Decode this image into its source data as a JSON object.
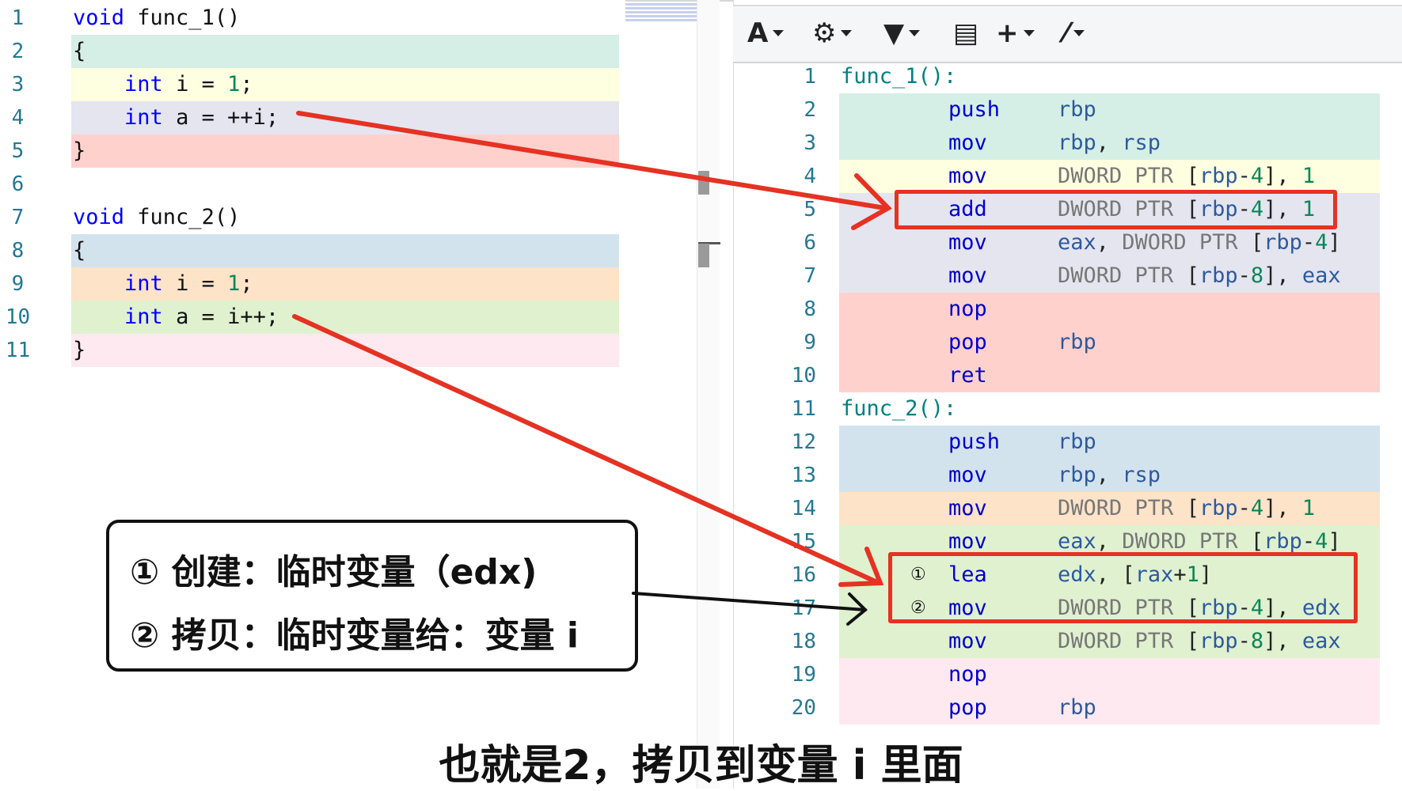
{
  "source_editor": {
    "lines": [
      {
        "num": "1",
        "tokens": [
          {
            "t": "void",
            "c": "kw"
          },
          {
            "t": " func_1()",
            "c": ""
          }
        ],
        "bg": ""
      },
      {
        "num": "2",
        "tokens": [
          {
            "t": "{",
            "c": ""
          }
        ],
        "bg": "#d5efe6"
      },
      {
        "num": "3",
        "tokens": [
          {
            "t": "    ",
            "c": ""
          },
          {
            "t": "int",
            "c": "kw"
          },
          {
            "t": " i = ",
            "c": ""
          },
          {
            "t": "1",
            "c": "num"
          },
          {
            "t": ";",
            "c": ""
          }
        ],
        "bg": "#fefee0"
      },
      {
        "num": "4",
        "tokens": [
          {
            "t": "    ",
            "c": ""
          },
          {
            "t": "int",
            "c": "kw"
          },
          {
            "t": " a = ++i;",
            "c": ""
          }
        ],
        "bg": "#e5e5f0"
      },
      {
        "num": "5",
        "tokens": [
          {
            "t": "}",
            "c": ""
          }
        ],
        "bg": "#ffd1cd"
      },
      {
        "num": "6",
        "tokens": [],
        "bg": ""
      },
      {
        "num": "7",
        "tokens": [
          {
            "t": "void",
            "c": "kw"
          },
          {
            "t": " func_2()",
            "c": ""
          }
        ],
        "bg": ""
      },
      {
        "num": "8",
        "tokens": [
          {
            "t": "{",
            "c": ""
          }
        ],
        "bg": "#d3e3ee"
      },
      {
        "num": "9",
        "tokens": [
          {
            "t": "    ",
            "c": ""
          },
          {
            "t": "int",
            "c": "kw"
          },
          {
            "t": " i = ",
            "c": ""
          },
          {
            "t": "1",
            "c": "num"
          },
          {
            "t": ";",
            "c": ""
          }
        ],
        "bg": "#fde3c8"
      },
      {
        "num": "10",
        "tokens": [
          {
            "t": "    ",
            "c": ""
          },
          {
            "t": "int",
            "c": "kw"
          },
          {
            "t": " a = i++;",
            "c": ""
          }
        ],
        "bg": "#e0f1cf"
      },
      {
        "num": "11",
        "tokens": [
          {
            "t": "}",
            "c": ""
          }
        ],
        "bg": "#fde9ef"
      }
    ]
  },
  "toolbar": {
    "buttons": [
      {
        "name": "font-button",
        "icon": "font-icon",
        "glyph": "A"
      },
      {
        "name": "settings-button",
        "icon": "gear-icon",
        "glyph": "⚙"
      },
      {
        "name": "filter-button",
        "icon": "filter-icon",
        "glyph": "▼"
      },
      {
        "name": "libraries-button",
        "icon": "book-icon",
        "glyph": "▤"
      },
      {
        "name": "add-button",
        "icon": "plus-icon",
        "glyph": "+"
      },
      {
        "name": "tools-button",
        "icon": "wrench-icon",
        "glyph": "⁄"
      }
    ]
  },
  "asm_output": {
    "lines": [
      {
        "num": "1",
        "label": "func_1():",
        "bg": "",
        "mn": "",
        "op": []
      },
      {
        "num": "2",
        "mn": "push",
        "op": [
          {
            "t": "rbp",
            "c": "reg"
          }
        ],
        "bg": "#d5efe6"
      },
      {
        "num": "3",
        "mn": "mov",
        "op": [
          {
            "t": "rbp",
            "c": "reg"
          },
          {
            "t": ", ",
            "c": "p"
          },
          {
            "t": "rsp",
            "c": "reg"
          }
        ],
        "bg": "#d5efe6"
      },
      {
        "num": "4",
        "mn": "mov",
        "op": [
          {
            "t": "DWORD PTR ",
            "c": "g"
          },
          {
            "t": "[",
            "c": "br"
          },
          {
            "t": "rbp",
            "c": "reg"
          },
          {
            "t": "-",
            "c": "p"
          },
          {
            "t": "4",
            "c": "n"
          },
          {
            "t": "]",
            "c": "br"
          },
          {
            "t": ", ",
            "c": "p"
          },
          {
            "t": "1",
            "c": "n"
          }
        ],
        "bg": "#fefee0"
      },
      {
        "num": "5",
        "mn": "add",
        "op": [
          {
            "t": "DWORD PTR ",
            "c": "g"
          },
          {
            "t": "[",
            "c": "br"
          },
          {
            "t": "rbp",
            "c": "reg"
          },
          {
            "t": "-",
            "c": "p"
          },
          {
            "t": "4",
            "c": "n"
          },
          {
            "t": "]",
            "c": "br"
          },
          {
            "t": ", ",
            "c": "p"
          },
          {
            "t": "1",
            "c": "n"
          }
        ],
        "bg": "#e5e5f0"
      },
      {
        "num": "6",
        "mn": "mov",
        "op": [
          {
            "t": "eax",
            "c": "reg"
          },
          {
            "t": ", ",
            "c": "p"
          },
          {
            "t": "DWORD PTR ",
            "c": "g"
          },
          {
            "t": "[",
            "c": "br"
          },
          {
            "t": "rbp",
            "c": "reg"
          },
          {
            "t": "-",
            "c": "p"
          },
          {
            "t": "4",
            "c": "n"
          },
          {
            "t": "]",
            "c": "br"
          }
        ],
        "bg": "#e5e5f0"
      },
      {
        "num": "7",
        "mn": "mov",
        "op": [
          {
            "t": "DWORD PTR ",
            "c": "g"
          },
          {
            "t": "[",
            "c": "br"
          },
          {
            "t": "rbp",
            "c": "reg"
          },
          {
            "t": "-",
            "c": "p"
          },
          {
            "t": "8",
            "c": "n"
          },
          {
            "t": "]",
            "c": "br"
          },
          {
            "t": ", ",
            "c": "p"
          },
          {
            "t": "eax",
            "c": "reg"
          }
        ],
        "bg": "#e5e5f0"
      },
      {
        "num": "8",
        "mn": "nop",
        "op": [],
        "bg": "#ffd1cd"
      },
      {
        "num": "9",
        "mn": "pop",
        "op": [
          {
            "t": "rbp",
            "c": "reg"
          }
        ],
        "bg": "#ffd1cd"
      },
      {
        "num": "10",
        "mn": "ret",
        "op": [],
        "bg": "#ffd1cd"
      },
      {
        "num": "11",
        "label": "func_2():",
        "bg": "",
        "mn": "",
        "op": []
      },
      {
        "num": "12",
        "mn": "push",
        "op": [
          {
            "t": "rbp",
            "c": "reg"
          }
        ],
        "bg": "#d3e3ee"
      },
      {
        "num": "13",
        "mn": "mov",
        "op": [
          {
            "t": "rbp",
            "c": "reg"
          },
          {
            "t": ", ",
            "c": "p"
          },
          {
            "t": "rsp",
            "c": "reg"
          }
        ],
        "bg": "#d3e3ee"
      },
      {
        "num": "14",
        "mn": "mov",
        "op": [
          {
            "t": "DWORD PTR ",
            "c": "g"
          },
          {
            "t": "[",
            "c": "br"
          },
          {
            "t": "rbp",
            "c": "reg"
          },
          {
            "t": "-",
            "c": "p"
          },
          {
            "t": "4",
            "c": "n"
          },
          {
            "t": "]",
            "c": "br"
          },
          {
            "t": ", ",
            "c": "p"
          },
          {
            "t": "1",
            "c": "n"
          }
        ],
        "bg": "#fde3c8"
      },
      {
        "num": "15",
        "mn": "mov",
        "op": [
          {
            "t": "eax",
            "c": "reg"
          },
          {
            "t": ", ",
            "c": "p"
          },
          {
            "t": "DWORD PTR ",
            "c": "g"
          },
          {
            "t": "[",
            "c": "br"
          },
          {
            "t": "rbp",
            "c": "reg"
          },
          {
            "t": "-",
            "c": "p"
          },
          {
            "t": "4",
            "c": "n"
          },
          {
            "t": "]",
            "c": "br"
          }
        ],
        "bg": "#e0f1cf"
      },
      {
        "num": "16",
        "marker": "①",
        "mn": "lea",
        "op": [
          {
            "t": "edx",
            "c": "reg"
          },
          {
            "t": ", ",
            "c": "p"
          },
          {
            "t": "[",
            "c": "br"
          },
          {
            "t": "rax",
            "c": "reg"
          },
          {
            "t": "+",
            "c": "p"
          },
          {
            "t": "1",
            "c": "n"
          },
          {
            "t": "]",
            "c": "br"
          }
        ],
        "bg": "#e0f1cf"
      },
      {
        "num": "17",
        "marker": "②",
        "mn": "mov",
        "op": [
          {
            "t": "DWORD PTR ",
            "c": "g"
          },
          {
            "t": "[",
            "c": "br"
          },
          {
            "t": "rbp",
            "c": "reg"
          },
          {
            "t": "-",
            "c": "p"
          },
          {
            "t": "4",
            "c": "n"
          },
          {
            "t": "]",
            "c": "br"
          },
          {
            "t": ", ",
            "c": "p"
          },
          {
            "t": "edx",
            "c": "reg"
          }
        ],
        "bg": "#e0f1cf"
      },
      {
        "num": "18",
        "mn": "mov",
        "op": [
          {
            "t": "DWORD PTR ",
            "c": "g"
          },
          {
            "t": "[",
            "c": "br"
          },
          {
            "t": "rbp",
            "c": "reg"
          },
          {
            "t": "-",
            "c": "p"
          },
          {
            "t": "8",
            "c": "n"
          },
          {
            "t": "]",
            "c": "br"
          },
          {
            "t": ", ",
            "c": "p"
          },
          {
            "t": "eax",
            "c": "reg"
          }
        ],
        "bg": "#e0f1cf"
      },
      {
        "num": "19",
        "mn": "nop",
        "op": [],
        "bg": "#fde9ef"
      },
      {
        "num": "20",
        "mn": "pop",
        "op": [
          {
            "t": "rbp",
            "c": "reg"
          }
        ],
        "bg": "#fde9ef"
      }
    ]
  },
  "annotation": {
    "line1": "① 创建：临时变量（edx)",
    "line2": "② 拷贝：临时变量给：变量 i"
  },
  "caption": "也就是2，拷贝到变量 i 里面",
  "colors": {
    "arrow": "#e53222",
    "callout_arrow": "#111111"
  }
}
